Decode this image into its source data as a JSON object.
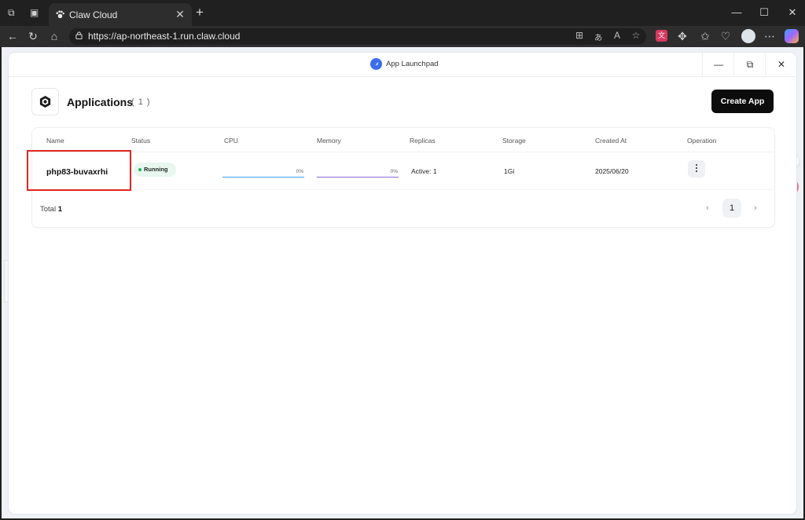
{
  "browser": {
    "tab_title": "Claw Cloud",
    "url": "https://ap-northeast-1.run.claw.cloud",
    "tab_close": "✕",
    "new_tab": "+",
    "minimize": "—",
    "maximize": "☐",
    "close": "✕"
  },
  "window": {
    "title": "App Launchpad",
    "minimize": "—",
    "restore": "⧉",
    "close": "✕"
  },
  "header": {
    "title": "Applications",
    "count": "( 1 )",
    "create_label": "Create App"
  },
  "table": {
    "columns": [
      "Name",
      "Status",
      "CPU",
      "Memory",
      "Replicas",
      "Storage",
      "Created At",
      "Operation"
    ],
    "rows": [
      {
        "name": "php83-buvaxrhi",
        "status": "Running",
        "cpu": "0%",
        "memory": "0%",
        "replicas": "Active: 1",
        "storage": "1Gi",
        "created_at": "2025/06/20"
      }
    ]
  },
  "footer": {
    "total_label": "Total",
    "total_value": "1",
    "current_page": "1",
    "prev": "‹",
    "next": "›"
  },
  "colors": {
    "accent": "#3d6cf0",
    "running": "#1cb35a",
    "cpu_bar": "#3aa0e8",
    "memory_bar": "#8a6ad6",
    "highlight": "#e0251f"
  },
  "icons": {
    "cpu_usage": 0,
    "memory_usage": 0
  }
}
